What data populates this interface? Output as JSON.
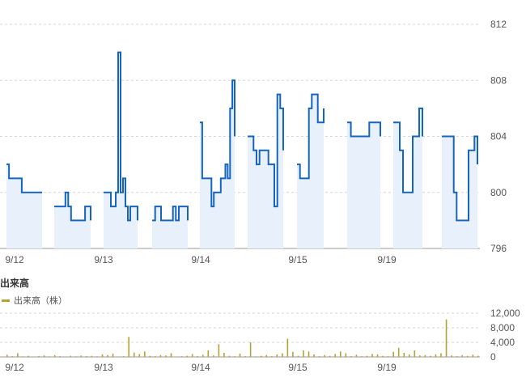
{
  "chart_data": [
    {
      "type": "line",
      "title": "",
      "ylim": [
        796,
        812
      ],
      "yticks": [
        812,
        808,
        804,
        800,
        796
      ],
      "x_labels": [
        "9/12",
        "9/13",
        "9/14",
        "9/15",
        "9/19"
      ],
      "grid": true,
      "colors": {
        "line": "#1565c0",
        "area": "#e8f1fb",
        "grid": "#d5d5d5"
      },
      "sessions": [
        {
          "values": [
            802,
            801,
            801,
            801,
            801,
            801,
            800,
            800,
            800,
            800,
            800,
            800,
            800,
            800,
            800
          ]
        },
        {
          "values": [
            799,
            799,
            799,
            799,
            800,
            799,
            798,
            798,
            798,
            798,
            798,
            799,
            799,
            798
          ]
        },
        {
          "values": [
            800,
            800,
            800,
            799,
            799,
            800,
            810,
            800,
            801,
            799,
            798,
            799,
            799,
            799,
            798
          ]
        },
        {
          "values": [
            798,
            799,
            799,
            798,
            798,
            798,
            798,
            799,
            798,
            799,
            799,
            799,
            798
          ]
        },
        {
          "values": [
            805,
            801,
            801,
            801,
            801,
            799,
            800,
            800,
            800,
            801,
            801,
            802,
            801,
            806,
            808,
            804
          ]
        },
        {
          "values": [
            804,
            804,
            803,
            802,
            803,
            803,
            803,
            802,
            802,
            799,
            807,
            806,
            803
          ]
        },
        {
          "values": [
            802,
            801,
            801,
            801,
            806,
            807,
            807,
            805,
            805,
            806
          ]
        },
        {
          "values": [
            805,
            804,
            804,
            804,
            804,
            804,
            805,
            805,
            805,
            804
          ]
        },
        {
          "values": [
            805,
            805,
            803,
            800,
            800,
            800,
            804,
            804,
            806,
            804
          ]
        },
        {
          "values": [
            804,
            804,
            804,
            804,
            800,
            798,
            798,
            798,
            798,
            803,
            803,
            804,
            802
          ]
        }
      ],
      "sessions_per_label": [
        2,
        2,
        2,
        2,
        2
      ]
    },
    {
      "type": "bar",
      "title": "出来高",
      "legend": "出来高（株）",
      "ylim": [
        0,
        12000
      ],
      "yticks": [
        12000,
        8000,
        4000,
        0
      ],
      "x_labels": [
        "9/12",
        "9/13",
        "9/14",
        "9/15",
        "9/19"
      ],
      "color": "#b5a232",
      "values": [
        600,
        200,
        1000,
        150,
        300,
        100,
        250,
        400,
        150,
        500,
        200,
        100,
        300,
        150,
        400,
        200,
        300,
        150,
        700,
        500,
        900,
        100,
        200,
        5500,
        1200,
        800,
        1500,
        300,
        200,
        500,
        400,
        1000,
        100,
        200,
        300,
        800,
        200,
        600,
        1800,
        400,
        3500,
        1100,
        300,
        200,
        900,
        200,
        4000,
        150,
        300,
        500,
        200,
        700,
        1000,
        5000,
        1400,
        300,
        1800,
        1500,
        700,
        200,
        500,
        300,
        800,
        1500,
        1000,
        200,
        600,
        200,
        300,
        800,
        700,
        300,
        200,
        1400,
        2500,
        1100,
        700,
        1800,
        400,
        500,
        300,
        700,
        1000,
        10300,
        400,
        200,
        500,
        300,
        600,
        300
      ]
    }
  ]
}
